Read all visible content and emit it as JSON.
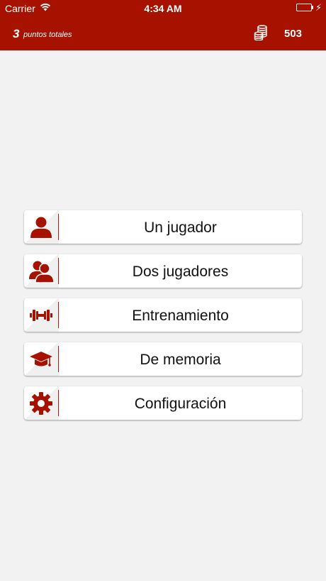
{
  "status_bar": {
    "carrier": "Carrier",
    "time": "4:34 AM",
    "battery_level": 1.0,
    "battery_color": "#34c759"
  },
  "header": {
    "points_count": "3",
    "points_label": "puntos totales",
    "coins_icon": "coins-icon",
    "coins_value": "503",
    "background": "#a61100"
  },
  "menu": {
    "accent": "#a61100",
    "items": [
      {
        "label": "Un jugador",
        "icon": "single-user-icon"
      },
      {
        "label": "Dos jugadores",
        "icon": "two-users-icon"
      },
      {
        "label": "Entrenamiento",
        "icon": "dumbbell-icon"
      },
      {
        "label": "De memoria",
        "icon": "graduation-cap-icon"
      },
      {
        "label": "Configuración",
        "icon": "gear-icon"
      }
    ]
  }
}
